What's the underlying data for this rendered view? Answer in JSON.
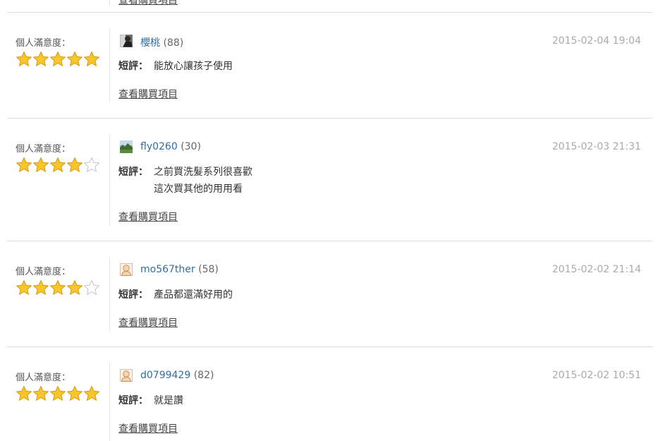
{
  "top_link": "查看購買項目",
  "reviews": [
    {
      "rating_label": "個人滿意度：",
      "rating": 5,
      "avatar": "photo-avatar-dark",
      "username": "櫻桃",
      "count": "(88)",
      "date": "2015-02-04 19:04",
      "comment_label": "短評：",
      "comment": "能放心讓孩子使用",
      "purchase_link": "查看購買項目"
    },
    {
      "rating_label": "個人滿意度：",
      "rating": 4,
      "avatar": "photo-avatar-landscape",
      "username": "fly0260",
      "count": "(30)",
      "date": "2015-02-03 21:31",
      "comment_label": "短評：",
      "comment": "之前買洗髮系列很喜歡\n這次買其他的用用看",
      "purchase_link": "查看購買項目"
    },
    {
      "rating_label": "個人滿意度：",
      "rating": 4,
      "avatar": "default-person-avatar",
      "username": "mo567ther",
      "count": "(58)",
      "date": "2015-02-02 21:14",
      "comment_label": "短評：",
      "comment": "產品都還滿好用的",
      "purchase_link": "查看購買項目"
    },
    {
      "rating_label": "個人滿意度：",
      "rating": 5,
      "avatar": "default-person-avatar",
      "username": "d0799429",
      "count": "(82)",
      "date": "2015-02-02 10:51",
      "comment_label": "短評：",
      "comment": "就是讚",
      "purchase_link": "查看購買項目"
    }
  ],
  "colors": {
    "star_fill": "#f7c52c",
    "star_stroke": "#d99a12",
    "star_empty_stroke": "#c4c4c4",
    "username": "#2f6fa7",
    "date": "#aaaaaa",
    "divider": "#dcdcdc"
  }
}
